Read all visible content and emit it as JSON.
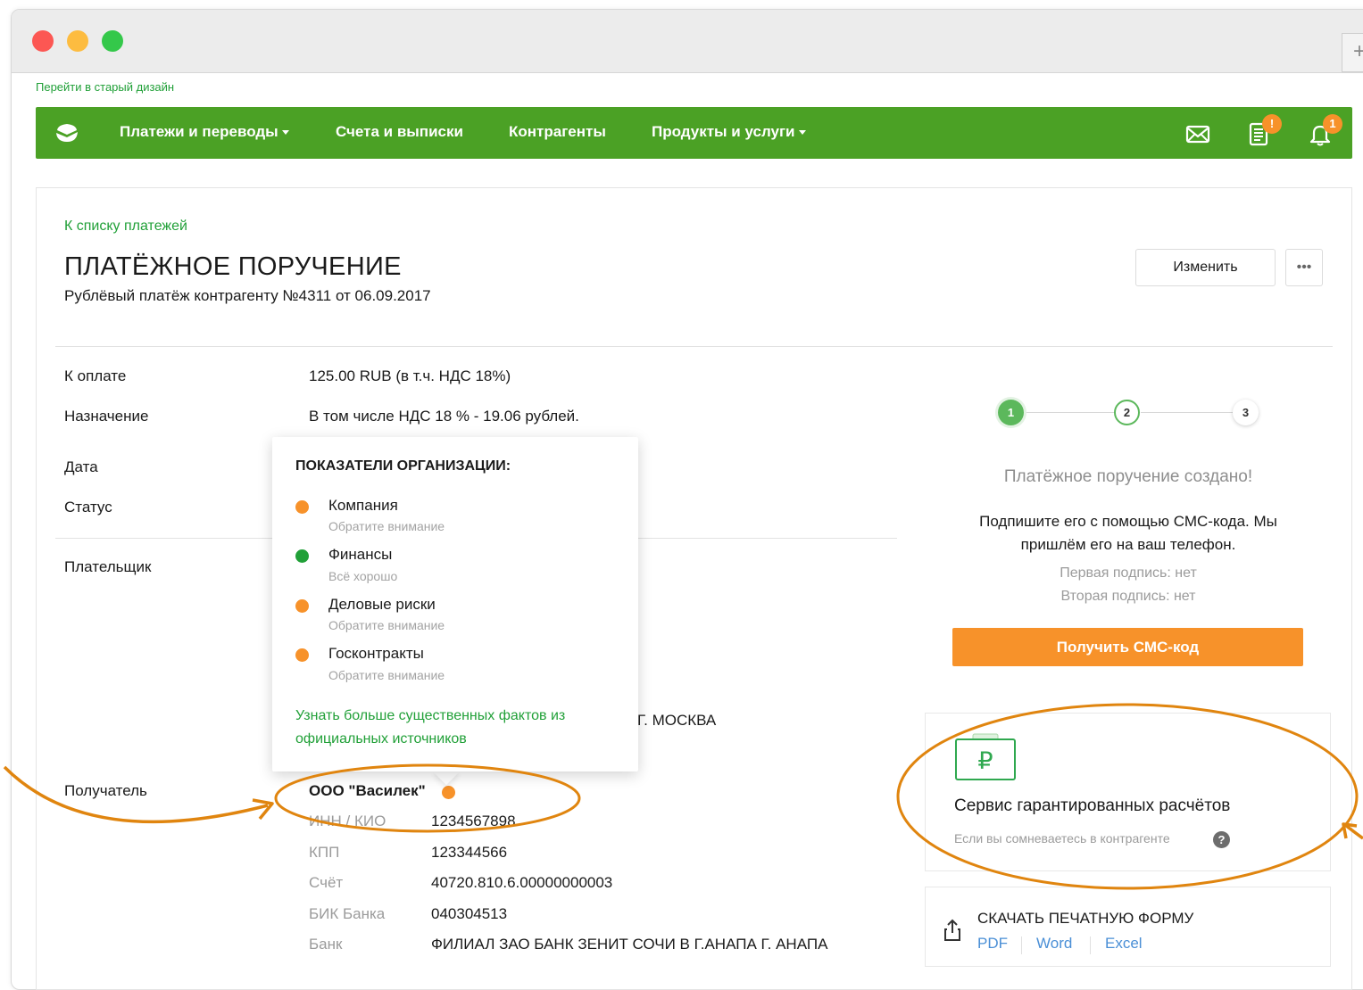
{
  "browser": {
    "new_tab_symbol": "+"
  },
  "top_link": "Перейти в старый дизайн",
  "nav": {
    "items": [
      {
        "label": "Платежи и переводы",
        "dropdown": true
      },
      {
        "label": "Счета и выписки",
        "dropdown": false
      },
      {
        "label": "Контрагенты",
        "dropdown": false
      },
      {
        "label": "Продукты и услуги",
        "dropdown": true
      }
    ],
    "icons": [
      {
        "name": "mail-icon",
        "badge": ""
      },
      {
        "name": "document-list-icon",
        "badge": "!"
      },
      {
        "name": "bell-icon",
        "badge": "1"
      }
    ],
    "brand_color": "#4ba125",
    "badge_color": "#f7922a"
  },
  "page": {
    "back_link": "К списку платежей",
    "title": "ПЛАТЁЖНОЕ ПОРУЧЕНИЕ",
    "subtitle": "Рублёвый платёж контрагенту №4311 от 06.09.2017",
    "edit_button": "Изменить",
    "more_button": "•••"
  },
  "details": {
    "amount_label": "К оплате",
    "amount_value": "125.00 RUB (в т.ч. НДС 18%)",
    "purpose_label": "Назначение",
    "purpose_value": "В том числе НДС 18 % - 19.06 рублей.",
    "date_label": "Дата",
    "status_label": "Статус",
    "payer_label": "Плательщик",
    "payer_city_tail": "Г. МОСКВА",
    "recipient_label": "Получатель",
    "recipient_name": "ООО \"Василек\"",
    "recipient_status_color": "#f7922a",
    "recipient_fields": [
      {
        "label": "ИНН / КИО",
        "value": "1234567898"
      },
      {
        "label": "КПП",
        "value": "123344566"
      },
      {
        "label": "Счёт",
        "value": "40720.810.6.00000000003"
      },
      {
        "label": "БИК Банка",
        "value": "040304513"
      },
      {
        "label": "Банк",
        "value": "ФИЛИАЛ ЗАО БАНК ЗЕНИТ СОЧИ В Г.АНАПА Г. АНАПА"
      }
    ]
  },
  "popup": {
    "title": "ПОКАЗАТЕЛИ ОРГАНИЗАЦИИ:",
    "indicators": [
      {
        "name": "Компания",
        "status": "Обратите внимание",
        "color": "#f7922a"
      },
      {
        "name": "Финансы",
        "status": "Всё хорошо",
        "color": "#21a038"
      },
      {
        "name": "Деловые риски",
        "status": "Обратите внимание",
        "color": "#f7922a"
      },
      {
        "name": "Госконтракты",
        "status": "Обратите внимание",
        "color": "#f7922a"
      }
    ],
    "link": "Узнать больше существенных фактов из официальных источников"
  },
  "steps": {
    "items": [
      "1",
      "2",
      "3"
    ],
    "current": 2
  },
  "sign": {
    "title": "Платёжное поручение создано!",
    "text": "Подпишите его с помощью СМС-кода. Мы пришлём его на ваш телефон.",
    "first_signature": "Первая подпись: нет",
    "second_signature": "Вторая подпись: нет",
    "sms_button": "Получить СМС-код",
    "button_color": "#f7922a"
  },
  "guarantee": {
    "icon": "ruble-briefcase-icon",
    "title": "Сервис гарантированных расчётов",
    "hint": "Если вы сомневаетесь в контрагенте",
    "help_symbol": "?"
  },
  "download": {
    "title": "СКАЧАТЬ ПЕЧАТНУЮ ФОРМУ",
    "formats": [
      "PDF",
      "Word",
      "Excel"
    ]
  },
  "annotation_color": "#e0850f"
}
